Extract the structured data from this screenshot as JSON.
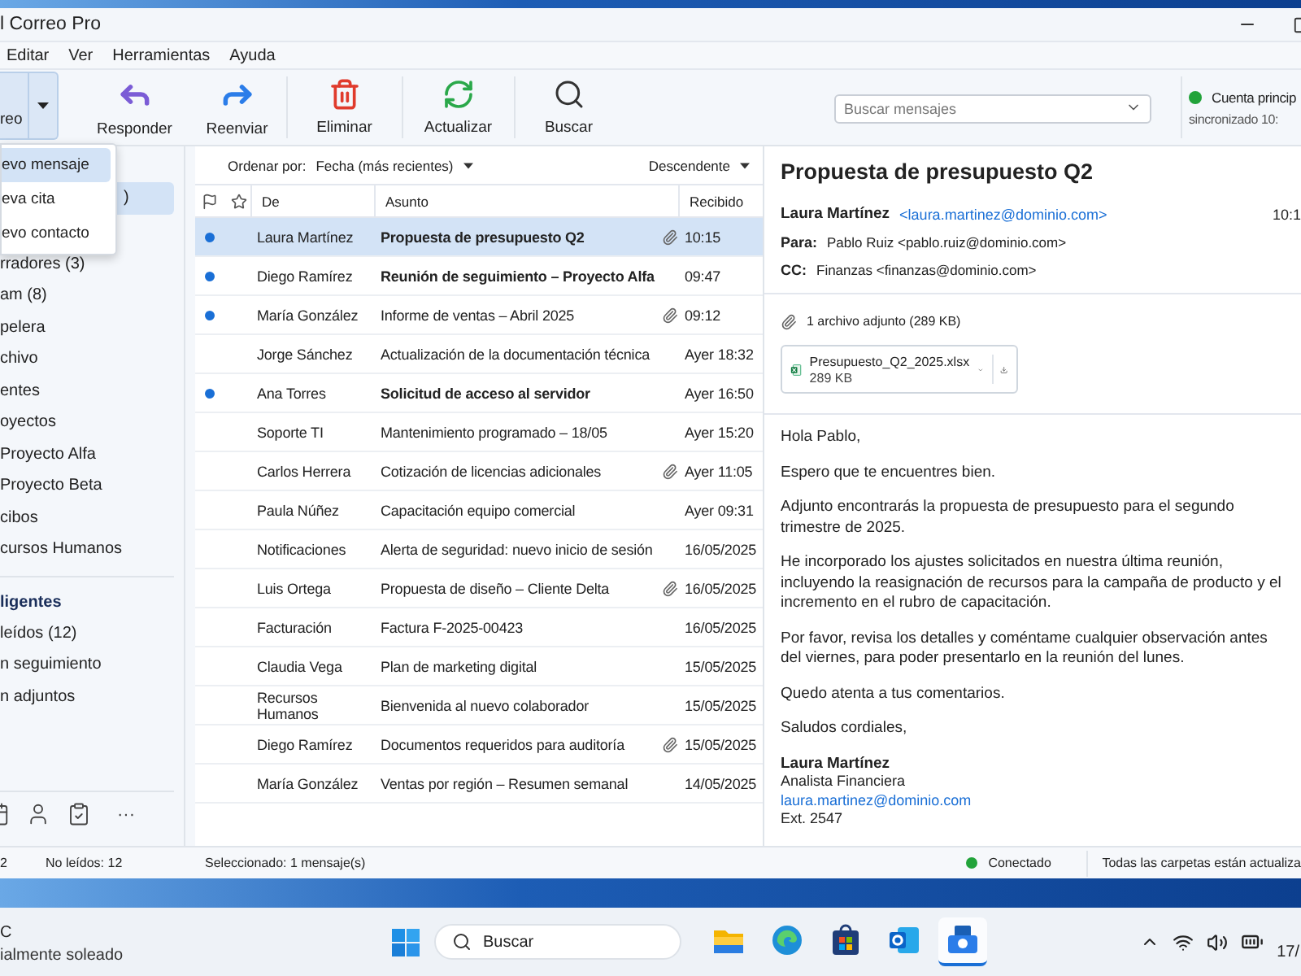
{
  "window": {
    "title": "l Correo Pro"
  },
  "menu_bar": [
    "Editar",
    "Ver",
    "Herramientas",
    "Ayuda"
  ],
  "toolbar": {
    "new_button": {
      "label": "reo"
    },
    "buttons": [
      {
        "kind": "reply",
        "label": "Responder"
      },
      {
        "kind": "forward",
        "label": "Reenviar"
      },
      {
        "kind": "delete",
        "label": "Eliminar"
      },
      {
        "kind": "refresh",
        "label": "Actualizar"
      },
      {
        "kind": "search",
        "label": "Buscar"
      }
    ],
    "search": {
      "placeholder": "Buscar mensajes"
    },
    "account": {
      "name": "Cuenta princip",
      "status": "sincronizado 10:",
      "online": true
    }
  },
  "new_menu": [
    {
      "label": "evo mensaje",
      "selected": true
    },
    {
      "label": "eva cita",
      "selected": false
    },
    {
      "label": "evo contacto",
      "selected": false
    }
  ],
  "sidebar": {
    "folders": [
      {
        "label": ")",
        "selected": true
      },
      {
        "label": "rradores (3)",
        "selected": false
      },
      {
        "label": "am (8)",
        "selected": false
      },
      {
        "label": "pelera",
        "selected": false
      },
      {
        "label": "chivo",
        "selected": false
      },
      {
        "label": "entes",
        "selected": false
      },
      {
        "label": "oyectos",
        "selected": false
      },
      {
        "label": "Proyecto Alfa",
        "selected": false
      },
      {
        "label": "Proyecto Beta",
        "selected": false
      },
      {
        "label": "cibos",
        "selected": false
      },
      {
        "label": "cursos Humanos",
        "selected": false
      }
    ],
    "smart_header": "ligentes",
    "smart_folders": [
      {
        "label": "leídos (12)",
        "selected": false
      },
      {
        "label": "n seguimiento",
        "selected": false
      },
      {
        "label": "n adjuntos",
        "selected": false
      }
    ],
    "more_label": "···"
  },
  "sort_bar": {
    "label": "Ordenar por:",
    "value": "Fecha (más recientes)",
    "order": "Descendente"
  },
  "columns": [
    "De",
    "Asunto",
    "Recibido"
  ],
  "messages": [
    {
      "from": "Laura Martínez",
      "subject": "Propuesta de presupuesto Q2",
      "received": "10:15",
      "unread": true,
      "bold": true,
      "attachment": true,
      "selected": true
    },
    {
      "from": "Diego Ramírez",
      "subject": "Reunión de seguimiento – Proyecto Alfa",
      "received": "09:47",
      "unread": true,
      "bold": true,
      "attachment": false,
      "selected": false
    },
    {
      "from": "María González",
      "subject": "Informe de ventas – Abril 2025",
      "received": "09:12",
      "unread": true,
      "bold": false,
      "attachment": true,
      "selected": false
    },
    {
      "from": "Jorge Sánchez",
      "subject": "Actualización de la documentación técnica",
      "received": "Ayer 18:32",
      "unread": false,
      "bold": false,
      "attachment": false,
      "selected": false
    },
    {
      "from": "Ana Torres",
      "subject": "Solicitud de acceso al servidor",
      "received": "Ayer 16:50",
      "unread": true,
      "bold": true,
      "attachment": false,
      "selected": false
    },
    {
      "from": "Soporte TI",
      "subject": "Mantenimiento programado – 18/05",
      "received": "Ayer 15:20",
      "unread": false,
      "bold": false,
      "attachment": false,
      "selected": false
    },
    {
      "from": "Carlos Herrera",
      "subject": "Cotización de licencias adicionales",
      "received": "Ayer 11:05",
      "unread": false,
      "bold": false,
      "attachment": true,
      "selected": false
    },
    {
      "from": "Paula Núñez",
      "subject": "Capacitación equipo comercial",
      "received": "Ayer 09:31",
      "unread": false,
      "bold": false,
      "attachment": false,
      "selected": false
    },
    {
      "from": "Notificaciones",
      "subject": "Alerta de seguridad: nuevo inicio de sesión",
      "received": "16/05/2025",
      "unread": false,
      "bold": false,
      "attachment": false,
      "selected": false
    },
    {
      "from": "Luis Ortega",
      "subject": "Propuesta de diseño – Cliente Delta",
      "received": "16/05/2025",
      "unread": false,
      "bold": false,
      "attachment": true,
      "selected": false
    },
    {
      "from": "Facturación",
      "subject": "Factura F-2025-00423",
      "received": "16/05/2025",
      "unread": false,
      "bold": false,
      "attachment": false,
      "selected": false
    },
    {
      "from": "Claudia Vega",
      "subject": "Plan de marketing digital",
      "received": "15/05/2025",
      "unread": false,
      "bold": false,
      "attachment": false,
      "selected": false
    },
    {
      "from": "Recursos Humanos",
      "subject": "Bienvenida al nuevo colaborador",
      "received": "15/05/2025",
      "unread": false,
      "bold": false,
      "attachment": false,
      "selected": false
    },
    {
      "from": "Diego Ramírez",
      "subject": "Documentos requeridos para auditoría",
      "received": "15/05/2025",
      "unread": false,
      "bold": false,
      "attachment": true,
      "selected": false
    },
    {
      "from": "María González",
      "subject": "Ventas por región – Resumen semanal",
      "received": "14/05/2025",
      "unread": false,
      "bold": false,
      "attachment": false,
      "selected": false
    }
  ],
  "reading_pane": {
    "subject": "Propuesta de presupuesto Q2",
    "sender": "Laura Martínez",
    "sender_email": "<laura.martinez@dominio.com>",
    "time": "10:1",
    "recipients": [
      {
        "label": "Para:",
        "value": "Pablo Ruiz <pablo.ruiz@dominio.com>"
      },
      {
        "label": "CC:",
        "value": "Finanzas <finanzas@dominio.com>"
      }
    ],
    "attachments_summary": "1 archivo adjunto (289 KB)",
    "attachment": {
      "name": "Presupuesto_Q2_2025.xlsx",
      "size": "289 KB"
    },
    "body": [
      "Hola Pablo,",
      "Espero que te encuentres bien.",
      "Adjunto encontrarás la propuesta de presupuesto para el segundo trimestre de 2025.",
      "He incorporado los ajustes solicitados en nuestra última reunión, incluyendo la reasignación de recursos para la campaña de producto y el incremento en el rubro de capacitación.",
      "Por favor, revisa los detalles y coméntame cualquier observación antes del viernes, para poder presentarlo en la reunión del lunes.",
      "Quedo atenta a tus comentarios.",
      "Saludos cordiales,"
    ],
    "signature": [
      {
        "kind": "name",
        "text": "Laura Martínez"
      },
      {
        "kind": "title",
        "text": "Analista Financiera"
      },
      {
        "kind": "email",
        "text": "laura.martinez@dominio.com"
      },
      {
        "kind": "phone",
        "text": "Ext. 2547"
      }
    ]
  },
  "status_bar": {
    "total": "2",
    "unread": "No leídos: 12",
    "selection": "Seleccionado: 1 mensaje(s)",
    "connection": "Conectado",
    "connected": true,
    "sync": "Todas las carpetas están actualiza"
  },
  "taskbar": {
    "weather_temp": "C",
    "weather_text": "ialmente soleado",
    "search": "Buscar",
    "apps": [
      {
        "kind": "files",
        "active": false
      },
      {
        "kind": "browser",
        "active": false
      },
      {
        "kind": "store",
        "active": false
      },
      {
        "kind": "mail",
        "active": false
      },
      {
        "kind": "client",
        "active": true
      }
    ],
    "clock": "17/"
  }
}
